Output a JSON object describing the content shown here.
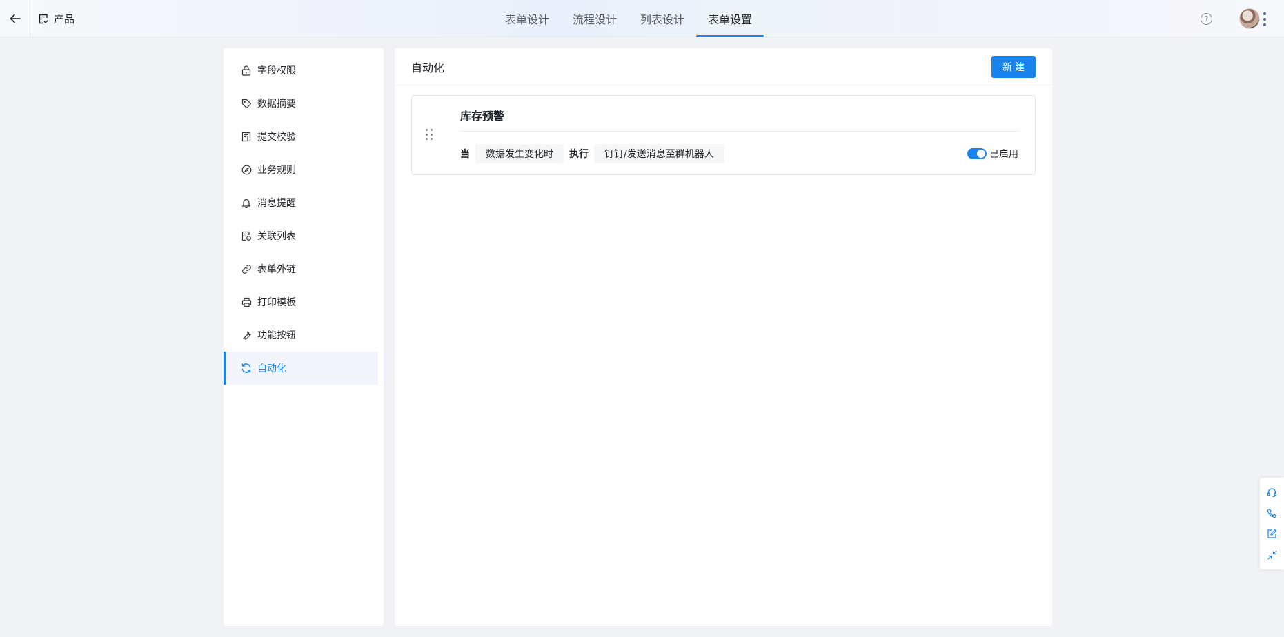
{
  "header": {
    "app_title": "产品",
    "tabs": [
      {
        "label": "表单设计",
        "active": false
      },
      {
        "label": "流程设计",
        "active": false
      },
      {
        "label": "列表设计",
        "active": false
      },
      {
        "label": "表单设置",
        "active": true
      }
    ],
    "help_symbol": "?"
  },
  "sidebar": {
    "items": [
      {
        "label": "字段权限",
        "icon": "lock-icon"
      },
      {
        "label": "数据摘要",
        "icon": "tag-icon"
      },
      {
        "label": "提交校验",
        "icon": "document-check-icon"
      },
      {
        "label": "业务规则",
        "icon": "compass-icon"
      },
      {
        "label": "消息提醒",
        "icon": "bell-icon"
      },
      {
        "label": "关联列表",
        "icon": "linked-list-icon"
      },
      {
        "label": "表单外链",
        "icon": "link-icon"
      },
      {
        "label": "打印模板",
        "icon": "printer-icon"
      },
      {
        "label": "功能按钮",
        "icon": "wrench-icon"
      },
      {
        "label": "自动化",
        "icon": "refresh-icon",
        "active": true
      }
    ]
  },
  "main": {
    "title": "自动化",
    "new_button_label": "新建",
    "rules": [
      {
        "name": "库存预警",
        "when_label": "当",
        "trigger": "数据发生变化时",
        "action_label": "执行",
        "action": "钉钉/发送消息至群机器人",
        "enabled": true,
        "status_label": "已启用"
      }
    ]
  },
  "colors": {
    "accent": "#1a84ee",
    "background": "#f0f2f5",
    "panel": "#ffffff"
  }
}
